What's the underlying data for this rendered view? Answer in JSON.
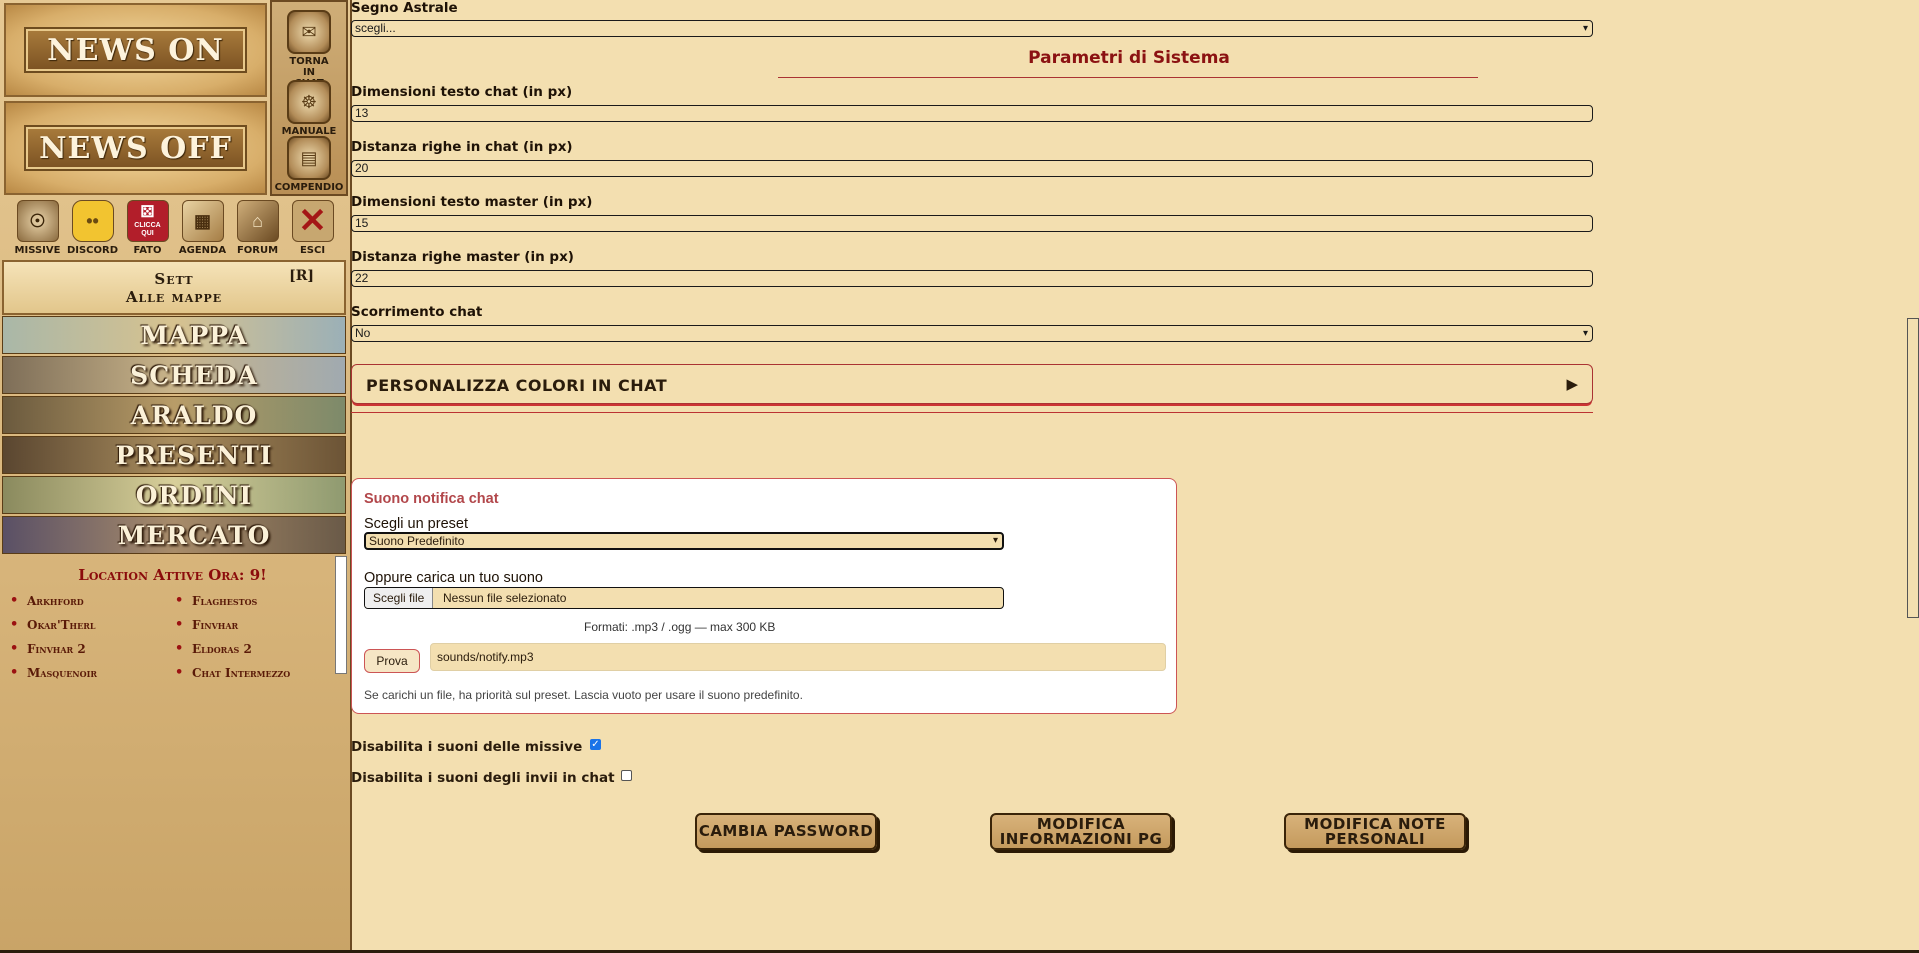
{
  "sidebar": {
    "news_on": "NEWS ON",
    "news_off": "NEWS OFF",
    "tools": [
      {
        "label": "TORNA IN CHAT",
        "icon": "chat-scroll-icon"
      },
      {
        "label": "MANUALE",
        "icon": "manual-book-icon"
      },
      {
        "label": "COMPENDIO",
        "icon": "compendium-book-icon"
      }
    ],
    "icons": [
      {
        "label": "MISSIVE",
        "icon": "missive-icon"
      },
      {
        "label": "DISCORD",
        "icon": "discord-icon"
      },
      {
        "label": "FATO",
        "icon": "dice-icon",
        "badge": "CLICCA QUI"
      },
      {
        "label": "AGENDA",
        "icon": "agenda-icon"
      },
      {
        "label": "FORUM",
        "icon": "forum-icon"
      },
      {
        "label": "ESCI",
        "icon": "exit-icon"
      }
    ],
    "sett_line1": "Sett",
    "sett_line2": "Alle mappe",
    "sett_r": "[R]",
    "nav": [
      "MAPPA",
      "SCHEDA",
      "ARALDO",
      "PRESENTI",
      "ORDINI",
      "MERCATO"
    ],
    "locations_title": "Location Attive Ora: 9!",
    "locations": [
      "Arkhford",
      "Flaghestos",
      "Okar'Therl",
      "Finvhar",
      "Finvhar 2",
      "Eldoras 2",
      "Masquenoir",
      "Chat Intermezzo"
    ]
  },
  "form": {
    "segno_label": "Segno Astrale",
    "segno_value": "scegli...",
    "system_title": "Parametri di Sistema",
    "chat_text_label": "Dimensioni testo chat (in px)",
    "chat_text_value": "13",
    "chat_lines_label": "Distanza righe in chat (in px)",
    "chat_lines_value": "20",
    "master_text_label": "Dimensioni testo master (in px)",
    "master_text_value": "15",
    "master_lines_label": "Distanza righe master (in px)",
    "master_lines_value": "22",
    "scroll_label": "Scorrimento chat",
    "scroll_value": "No",
    "colors_label": "PERSONALIZZA COLORI IN CHAT"
  },
  "sound": {
    "title": "Suono notifica chat",
    "preset_label": "Scegli un preset",
    "preset_value": "Suono Predefinito",
    "upload_label": "Oppure carica un tuo suono",
    "file_button": "Scegli file",
    "file_none": "Nessun file selezionato",
    "formats": "Formati: .mp3 / .ogg — max 300 KB",
    "try_button": "Prova",
    "path_value": "sounds/notify.mp3",
    "help": "Se carichi un file, ha priorità sul preset. Lascia vuoto per usare il suono predefinito."
  },
  "checks": {
    "missive_label": "Disabilita i suoni delle missive",
    "missive_checked": true,
    "chat_label": "Disabilita i suoni degli invii in chat",
    "chat_checked": false
  },
  "buttons": {
    "password": "CAMBIA PASSWORD",
    "info": "MODIFICA INFORMAZIONI PG",
    "notes": "MODIFICA NOTE PERSONALI"
  }
}
